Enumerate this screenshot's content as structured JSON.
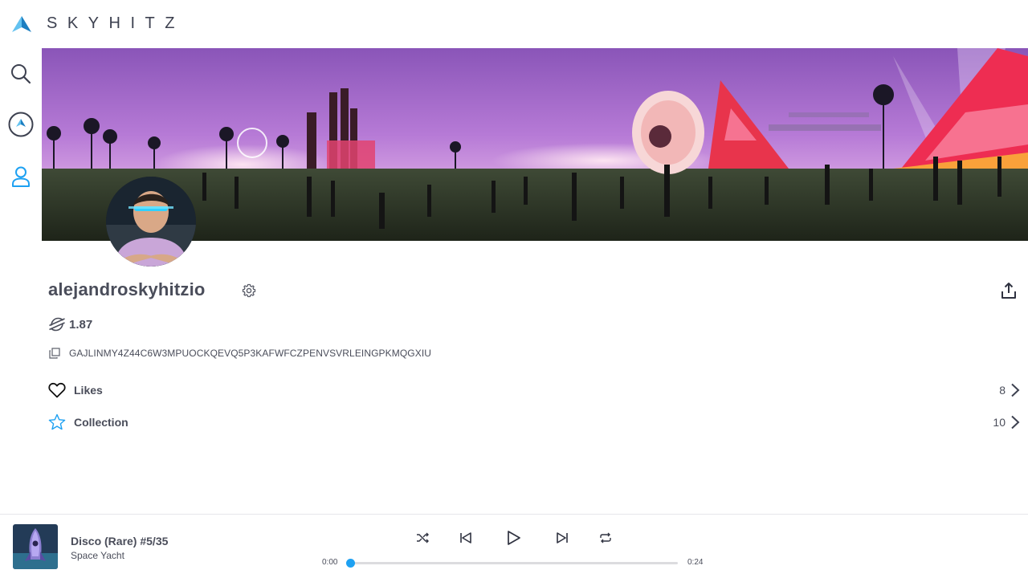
{
  "brand": {
    "name": "SKYHITZ"
  },
  "sidebar": {
    "items": [
      {
        "name": "search",
        "icon": "search-icon"
      },
      {
        "name": "home",
        "icon": "skyhitz-logo-icon"
      },
      {
        "name": "profile",
        "icon": "user-icon",
        "active": true
      }
    ]
  },
  "profile": {
    "username": "alejandroskyhitzio",
    "balance": "1.87",
    "currency_icon": "stellar-icon",
    "address": "GAJLINMY4Z44C6W3MPUOCKQEVQ5P3KAFWFCZPENVSVRLEINGPKMQGXIU",
    "rows": [
      {
        "label": "Likes",
        "count": "8",
        "icon": "heart-icon"
      },
      {
        "label": "Collection",
        "count": "10",
        "icon": "star-icon"
      }
    ]
  },
  "player": {
    "title": "Disco (Rare) #5/35",
    "artist": "Space Yacht",
    "current_time": "0:00",
    "duration": "0:24",
    "progress": 0.0
  },
  "colors": {
    "accent": "#1ea1f2",
    "text": "#4a4d5a"
  }
}
